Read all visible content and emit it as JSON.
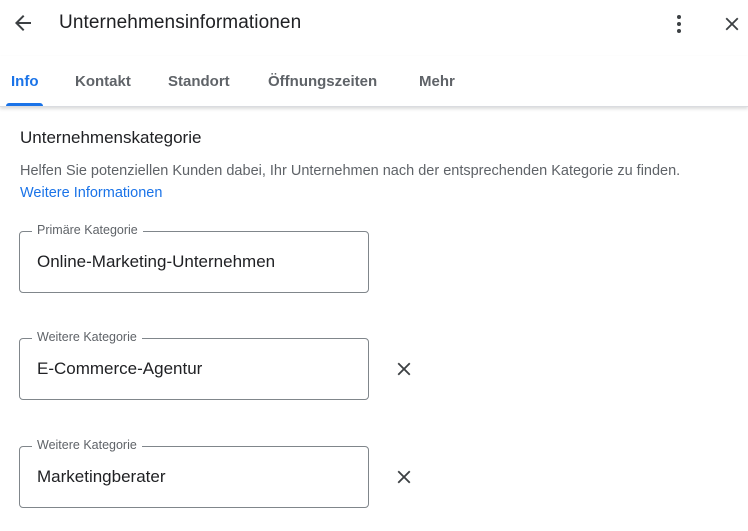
{
  "header": {
    "title": "Unternehmensinformationen",
    "back_icon": "arrow-back-icon",
    "more_icon": "more-vert-icon",
    "close_icon": "close-icon"
  },
  "tabs": [
    {
      "label": "Info",
      "active": true
    },
    {
      "label": "Kontakt",
      "active": false
    },
    {
      "label": "Standort",
      "active": false
    },
    {
      "label": "Öffnungszeiten",
      "active": false
    },
    {
      "label": "Mehr",
      "active": false
    }
  ],
  "section": {
    "title": "Unternehmenskategorie",
    "description": "Helfen Sie potenziellen Kunden dabei, Ihr Unternehmen nach der entsprechenden Kategorie zu finden.",
    "link_text": "Weitere Informationen"
  },
  "fields": [
    {
      "label": "Primäre Kategorie",
      "value": "Online-Marketing-Unternehmen"
    },
    {
      "label": "Weitere Kategorie",
      "value": "E-Commerce-Agentur"
    },
    {
      "label": "Weitere Kategorie",
      "value": "Marketingberater"
    }
  ],
  "colors": {
    "accent": "#1a73e8",
    "text": "#202124",
    "secondary_text": "#5f6368",
    "outline": "#80868b"
  }
}
